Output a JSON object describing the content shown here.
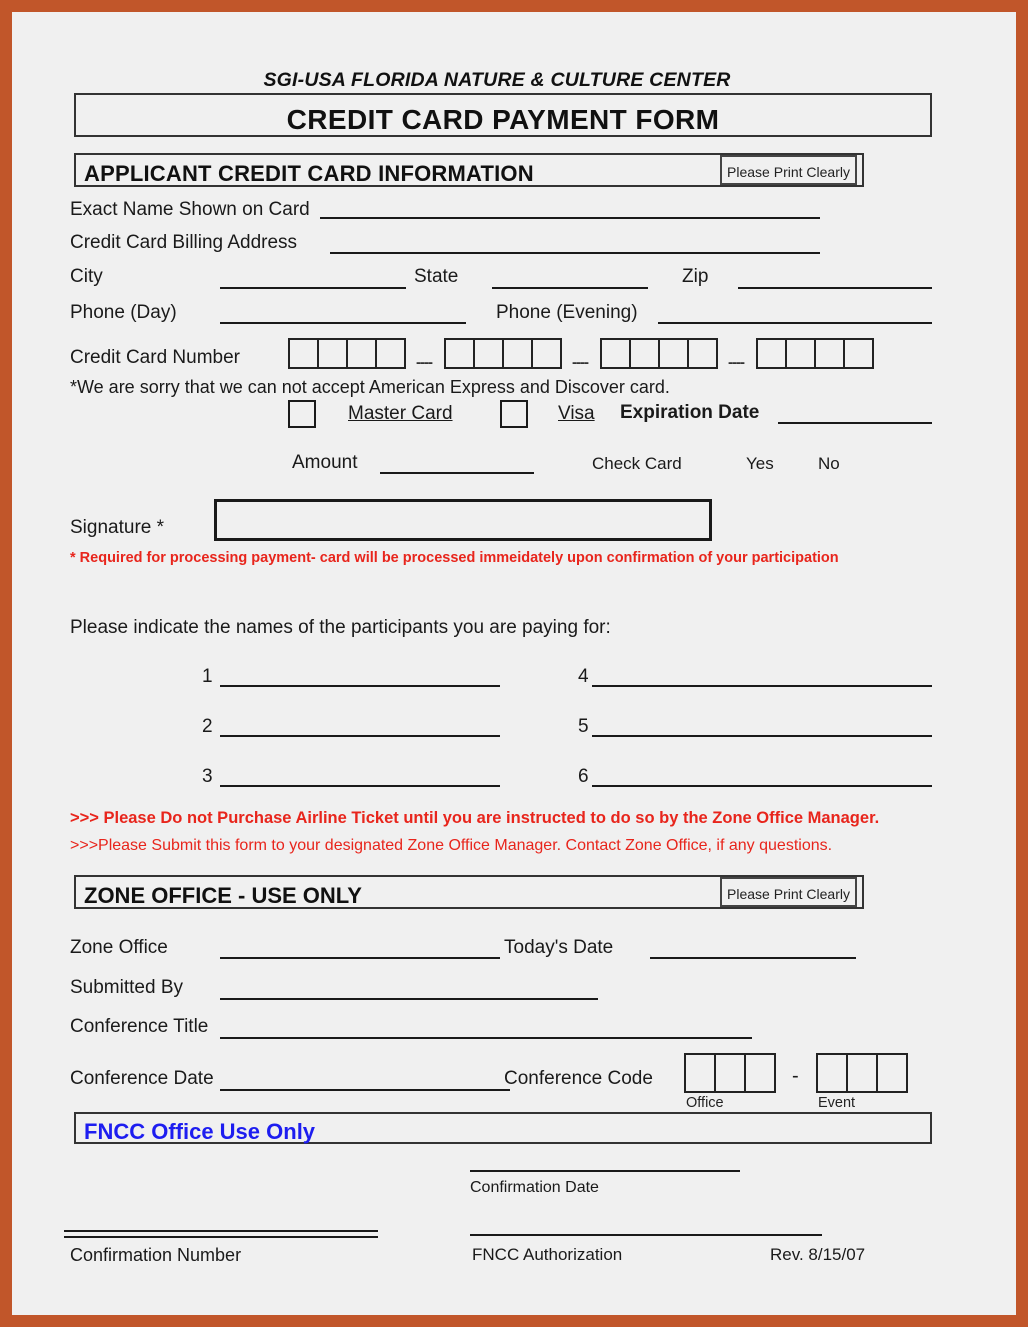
{
  "colors": {
    "page_border": "#c1562a",
    "page_background": "#f0f0f0",
    "red_note": "#e8251c",
    "fncc_blue": "#1d1df0",
    "ink": "#1a1a1a"
  },
  "header": {
    "organization": "SGI-USA FLORIDA NATURE & CULTURE CENTER",
    "form_title": "CREDIT CARD PAYMENT FORM"
  },
  "applicant_section": {
    "heading": "APPLICANT CREDIT CARD INFORMATION",
    "print_clearly_note": "Please Print Clearly",
    "fields": {
      "exact_name": "Exact Name Shown on Card",
      "billing_address": "Credit Card Billing Address",
      "city": "City",
      "state": "State",
      "zip": "Zip",
      "phone_day": "Phone (Day)",
      "phone_evening": "Phone (Evening)",
      "card_number": "Credit Card Number",
      "expiration_date": "Expiration Date",
      "amount": "Amount",
      "check_card": "Check Card",
      "yes": "Yes",
      "no": "No",
      "signature": "Signature *"
    },
    "card_number_groups": 4,
    "card_number_digits_per_group": 4,
    "card_number_separator": "----",
    "card_types": [
      {
        "label": "Master Card"
      },
      {
        "label": "Visa"
      }
    ],
    "not_accepted_note": "*We are sorry that we can not accept American Express and Discover card.",
    "signature_required_note": "* Required for processing payment- card will be processed immeidately upon confirmation of your participation"
  },
  "participants_section": {
    "prompt": "Please indicate the names of the participants you are paying for:",
    "left_numbers": [
      "1",
      "2",
      "3"
    ],
    "right_numbers": [
      "4",
      "5",
      "6"
    ]
  },
  "warnings": {
    "airline": ">>> Please Do not Purchase Airline Ticket until you are instructed to do so by the Zone Office Manager.",
    "submit": ">>>Please Submit this form to your designated Zone Office Manager. Contact Zone Office, if any questions."
  },
  "zone_office_section": {
    "heading": "ZONE OFFICE - USE ONLY",
    "print_clearly_note": "Please Print Clearly",
    "fields": {
      "zone_office": "Zone Office",
      "todays_date": "Today's Date",
      "submitted_by": "Submitted By",
      "conference_title": "Conference Title",
      "conference_date": "Conference Date",
      "conference_code": "Conference Code"
    },
    "conference_code": {
      "office_label": "Office",
      "event_label": "Event",
      "office_boxes": 3,
      "event_boxes": 3,
      "separator": "-"
    }
  },
  "fncc_section": {
    "heading": "FNCC Office Use Only",
    "confirmation_date": "Confirmation Date",
    "confirmation_number": "Confirmation Number",
    "fncc_authorization": "FNCC Authorization",
    "revision": "Rev. 8/15/07"
  }
}
